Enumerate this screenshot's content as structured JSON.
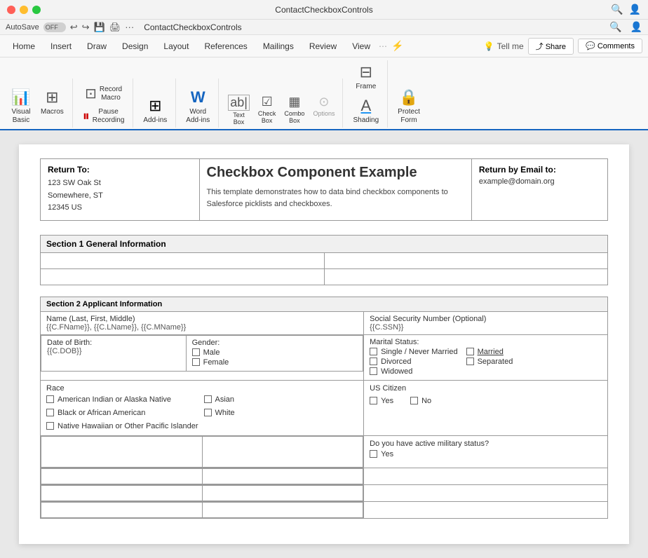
{
  "titleBar": {
    "title": "ContactCheckboxControls",
    "trafficLights": [
      "red",
      "yellow",
      "green"
    ]
  },
  "autosaveBar": {
    "label": "AutoSave",
    "toggleText": "OFF",
    "icons": [
      "↩",
      "↪",
      "⊡",
      "✂"
    ],
    "docTitle": "ContactCheckboxControls"
  },
  "ribbonNav": {
    "items": [
      "Home",
      "Insert",
      "Draw",
      "Design",
      "Layout",
      "References",
      "Mailings",
      "Review",
      "View"
    ],
    "tellMe": "Tell me",
    "share": "Share",
    "comments": "Comments"
  },
  "toolbar": {
    "groups": [
      {
        "name": "basic",
        "buttons": [
          {
            "id": "visual-basic",
            "icon": "📊",
            "label": "Visual\nBasic"
          },
          {
            "id": "macros",
            "icon": "⊞",
            "label": "Macros"
          }
        ]
      },
      {
        "name": "code",
        "buttons": [
          {
            "id": "record-macro",
            "icon": "⊡",
            "label": "Record\nMacro"
          },
          {
            "id": "pause-recording",
            "icon": "⏸",
            "label": "Pause\nRecording"
          }
        ]
      },
      {
        "name": "addins",
        "buttons": [
          {
            "id": "add-ins",
            "icon": "⊞",
            "label": "Add-ins"
          }
        ]
      },
      {
        "name": "word",
        "buttons": [
          {
            "id": "word-add-ins",
            "icon": "W",
            "label": "Word\nAdd-ins"
          }
        ]
      },
      {
        "name": "controls",
        "buttons": [
          {
            "id": "text-box",
            "icon": "ab|",
            "label": "Text\nBox"
          },
          {
            "id": "check-box",
            "icon": "☑",
            "label": "Check\nBox"
          },
          {
            "id": "combo-box",
            "icon": "▦",
            "label": "Combo\nBox"
          },
          {
            "id": "options",
            "icon": "⊙",
            "label": "Options",
            "disabled": true
          }
        ]
      },
      {
        "name": "layout",
        "buttons": [
          {
            "id": "frame",
            "icon": "⊟",
            "label": "Frame"
          },
          {
            "id": "shading",
            "icon": "A",
            "label": "Shading"
          }
        ]
      },
      {
        "name": "protect",
        "buttons": [
          {
            "id": "protect-form",
            "icon": "🔒",
            "label": "Protect\nForm"
          }
        ]
      }
    ]
  },
  "header": {
    "returnTo": {
      "label": "Return To:",
      "address": "123 SW Oak St\nSomewhere, ST\n12345 US"
    },
    "title": "Checkbox Component Example",
    "description": "This template demonstrates how to data bind checkbox components to Salesforce picklists and checkboxes.",
    "returnEmail": {
      "label": "Return by Email to:",
      "email": "example@domain.org"
    }
  },
  "section1": {
    "title": "Section 1 General Information",
    "rows": [
      [
        "",
        ""
      ],
      [
        "",
        ""
      ]
    ]
  },
  "section2": {
    "title": "Section 2 Applicant Information",
    "nameLabel": "Name (Last, First, Middle)",
    "nameValue": "{{C.FName}}, {{C.LName}}, {{C.MName}}",
    "ssnLabel": "Social Security Number (Optional)",
    "ssnValue": "{{C.SSN}}",
    "dobLabel": "Date of Birth:",
    "dobValue": "{{C.DOB}}",
    "genderLabel": "Gender:",
    "genderOptions": [
      "Male",
      "Female"
    ],
    "maritalLabel": "Marital Status:",
    "maritalOptions": [
      {
        "label": "Single / Never Married",
        "col": "left"
      },
      {
        "label": "Married",
        "col": "right",
        "underline": true
      },
      {
        "label": "Divorced",
        "col": "left"
      },
      {
        "label": "Separated",
        "col": "right"
      },
      {
        "label": "Widowed",
        "col": "left"
      }
    ],
    "raceLabel": "Race",
    "raceOptions": [
      "American Indian or Alaska Native",
      "Asian",
      "Black or African American",
      "White",
      "Native Hawaiian or Other Pacific Islander"
    ],
    "citizenLabel": "US Citizen",
    "citizenOptions": [
      "Yes",
      "No"
    ],
    "militaryLabel": "Do you have active military status?",
    "militaryOptions": [
      "Yes"
    ],
    "emptyRows": 4
  }
}
